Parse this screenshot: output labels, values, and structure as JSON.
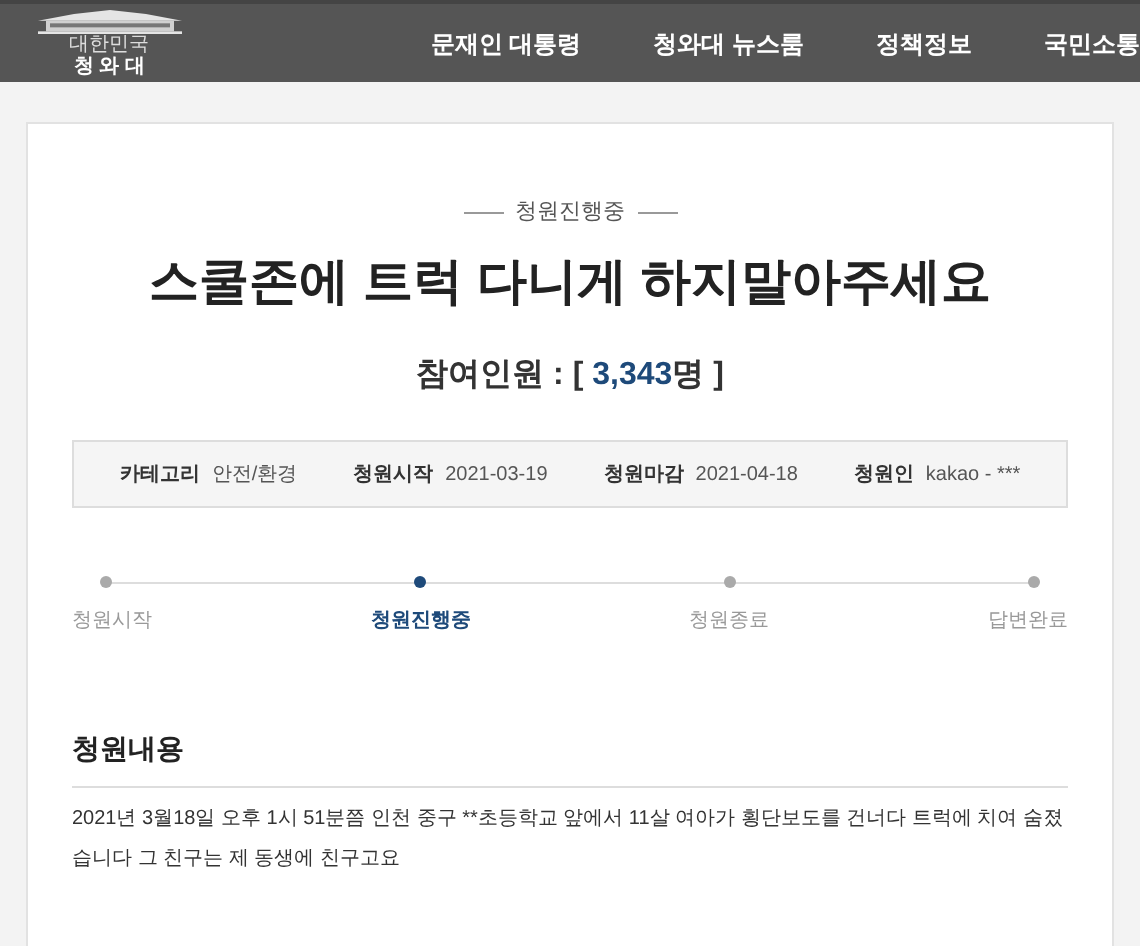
{
  "header": {
    "logo": {
      "small": "대한민국",
      "name": "청 와 대"
    },
    "nav": [
      "문재인 대통령",
      "청와대 뉴스룸",
      "정책정보",
      "국민소통"
    ]
  },
  "petition": {
    "status": "청원진행중",
    "title": "스쿨존에 트럭 다니게 하지말아주세요",
    "participants": {
      "label": "참여인원 :",
      "open": "[",
      "count": "3,343",
      "unit": "명",
      "close": "]"
    },
    "info": [
      {
        "label": "카테고리",
        "value": "안전/환경"
      },
      {
        "label": "청원시작",
        "value": "2021-03-19"
      },
      {
        "label": "청원마감",
        "value": "2021-04-18"
      },
      {
        "label": "청원인",
        "value": "kakao - ***"
      }
    ],
    "steps": [
      {
        "label": "청원시작",
        "selected": false
      },
      {
        "label": "청원진행중",
        "selected": true
      },
      {
        "label": "청원종료",
        "selected": false
      },
      {
        "label": "답변완료",
        "selected": false
      }
    ],
    "content": {
      "heading": "청원내용",
      "text": "2021년 3월18일 오후 1시 51분쯤 인천 중구 **초등학교 앞에서 11살 여아가 횡단보도를 건너다 트럭에 치여 숨졌습니다 그 친구는 제 동생에 친구고요"
    }
  }
}
